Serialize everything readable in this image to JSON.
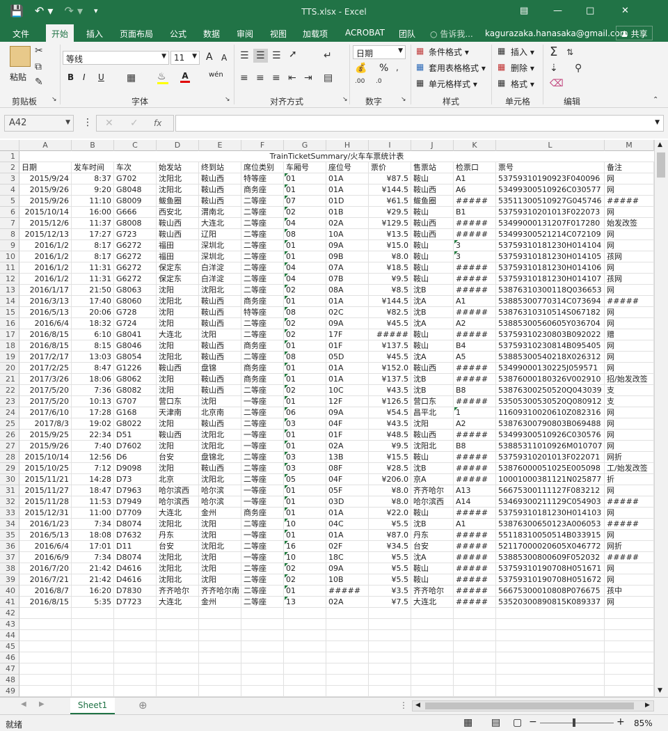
{
  "app": {
    "title": "TTS.xlsx - Excel"
  },
  "menu": [
    "文件",
    "开始",
    "插入",
    "页面布局",
    "公式",
    "数据",
    "审阅",
    "视图",
    "加载项",
    "ACROBAT",
    "团队"
  ],
  "tell_me": "告诉我...",
  "account": "kagurazaka.hanasaka@gmail.com",
  "share": "共享",
  "ribbon": {
    "clipboard": {
      "label": "剪贴板",
      "paste": "粘贴"
    },
    "font": {
      "label": "字体",
      "name": "等线",
      "size": "11",
      "bold": "B",
      "italic": "I",
      "underline": "U",
      "grow": "A",
      "shrink": "A",
      "phonetic": "wén"
    },
    "alignment": {
      "label": "对齐方式"
    },
    "number": {
      "label": "数字",
      "format": "日期",
      "percent": "%"
    },
    "styles": {
      "label": "样式",
      "conditional": "条件格式",
      "table": "套用表格格式",
      "cell": "单元格样式"
    },
    "cells": {
      "label": "单元格",
      "insert": "插入",
      "delete": "删除",
      "format": "格式"
    },
    "editing": {
      "label": "编辑"
    }
  },
  "formula_bar": {
    "name_box": "A42",
    "fx": "fx",
    "formula": ""
  },
  "columns": [
    "A",
    "B",
    "C",
    "D",
    "E",
    "F",
    "G",
    "H",
    "I",
    "J",
    "K",
    "L",
    "M"
  ],
  "sheet_title": "TrainTicketSummary/火车车票统计表",
  "headers": [
    "日期",
    "发车时间",
    "车次",
    "始发站",
    "终到站",
    "席位类别",
    "车厢号",
    "座位号",
    "票价",
    "售票站",
    "检票口",
    "票号",
    "备注"
  ],
  "rows": [
    [
      "2015/9/24",
      "8:37",
      "G702",
      "沈阳北",
      "鞍山西",
      "特等座",
      "01",
      "01A",
      "¥87.5",
      "鞍山",
      "A1",
      "53759310190923F040096",
      "网"
    ],
    [
      "2015/9/26",
      "9:20",
      "G8048",
      "沈阳北",
      "鞍山西",
      "商务座",
      "01",
      "01A",
      "¥144.5",
      "鞍山西",
      "A6",
      "53499300510926C030577",
      "网"
    ],
    [
      "2015/9/26",
      "11:10",
      "G8009",
      "鲅鱼圈",
      "鞍山西",
      "二等座",
      "07",
      "01D",
      "¥61.5",
      "鲅鱼圈",
      "#####",
      "53511300510927G045746",
      "#####"
    ],
    [
      "2015/10/14",
      "16:00",
      "G666",
      "西安北",
      "渭南北",
      "二等座",
      "02",
      "01B",
      "¥29.5",
      "鞍山",
      "B1",
      "53759310201013F022073",
      "网"
    ],
    [
      "2015/12/6",
      "11:37",
      "G8008",
      "鞍山西",
      "大连北",
      "二等座",
      "04",
      "02A",
      "¥129.5",
      "鞍山西",
      "#####",
      "53499000131207F017280",
      "始发改签"
    ],
    [
      "2015/12/13",
      "17:27",
      "G723",
      "鞍山西",
      "辽阳",
      "二等座",
      "08",
      "10A",
      "¥13.5",
      "鞍山西",
      "#####",
      "53499300521214C072109",
      "网"
    ],
    [
      "2016/1/2",
      "8:17",
      "G6272",
      "福田",
      "深圳北",
      "二等座",
      "01",
      "09A",
      "¥15.0",
      "鞍山",
      "3",
      "53759310181230H014104",
      "网"
    ],
    [
      "2016/1/2",
      "8:17",
      "G6272",
      "福田",
      "深圳北",
      "二等座",
      "01",
      "09B",
      "¥8.0",
      "鞍山",
      "3",
      "53759310181230H014105",
      "孩网"
    ],
    [
      "2016/1/2",
      "11:31",
      "G6272",
      "保定东",
      "白洋淀",
      "二等座",
      "04",
      "07A",
      "¥18.5",
      "鞍山",
      "#####",
      "53759310181230H014106",
      "网"
    ],
    [
      "2016/1/2",
      "11:31",
      "G6272",
      "保定东",
      "白洋淀",
      "二等座",
      "04",
      "07B",
      "¥9.5",
      "鞍山",
      "#####",
      "53759310181230H014107",
      "孩网"
    ],
    [
      "2016/1/17",
      "21:50",
      "G8063",
      "沈阳",
      "沈阳北",
      "二等座",
      "02",
      "08A",
      "¥8.5",
      "沈B",
      "#####",
      "53876310300118Q036653",
      "网"
    ],
    [
      "2016/3/13",
      "17:40",
      "G8060",
      "沈阳北",
      "鞍山西",
      "商务座",
      "01",
      "01A",
      "¥144.5",
      "沈A",
      "A1",
      "53885300770314C073694",
      "#####"
    ],
    [
      "2016/5/13",
      "20:06",
      "G728",
      "沈阳",
      "鞍山西",
      "特等座",
      "08",
      "02C",
      "¥82.5",
      "沈B",
      "#####",
      "53876310310514S067182",
      "网"
    ],
    [
      "2016/6/4",
      "18:32",
      "G724",
      "沈阳",
      "鞍山西",
      "二等座",
      "02",
      "09A",
      "¥45.5",
      "沈A",
      "A2",
      "53885300560605Y036704",
      "网"
    ],
    [
      "2016/8/15",
      "6:10",
      "G8041",
      "大连北",
      "沈阳",
      "二等座",
      "02",
      "17F",
      "#####",
      "鞍山",
      "#####",
      "53759310230803B092022",
      "赠"
    ],
    [
      "2016/8/15",
      "8:15",
      "G8046",
      "沈阳",
      "鞍山西",
      "商务座",
      "01",
      "01F",
      "¥137.5",
      "鞍山",
      "B4",
      "53759310230814B095405",
      "网"
    ],
    [
      "2017/2/17",
      "13:03",
      "G8054",
      "沈阳北",
      "鞍山西",
      "二等座",
      "08",
      "05D",
      "¥45.5",
      "沈A",
      "A5",
      "53885300540218X026312",
      "网"
    ],
    [
      "2017/2/25",
      "8:47",
      "G1226",
      "鞍山西",
      "盘锦",
      "商务座",
      "01",
      "01A",
      "¥152.0",
      "鞍山西",
      "#####",
      "53499000130225J059571",
      "网"
    ],
    [
      "2017/3/26",
      "18:06",
      "G8062",
      "沈阳",
      "鞍山西",
      "商务座",
      "01",
      "01A",
      "¥137.5",
      "沈B",
      "#####",
      "53876000180326V002910",
      "招/始发改签"
    ],
    [
      "2017/5/20",
      "7:36",
      "G8082",
      "沈阳",
      "鞍山西",
      "二等座",
      "02",
      "10C",
      "¥43.5",
      "沈B",
      "B8",
      "53876300250520Q043039",
      "支"
    ],
    [
      "2017/5/20",
      "10:13",
      "G707",
      "营口东",
      "沈阳",
      "一等座",
      "01",
      "12F",
      "¥126.5",
      "营口东",
      "#####",
      "53505300530520Q080912",
      "支"
    ],
    [
      "2017/6/10",
      "17:28",
      "G168",
      "天津南",
      "北京南",
      "二等座",
      "06",
      "09A",
      "¥54.5",
      "昌平北",
      "1",
      "11609310020610Z082316",
      "网"
    ],
    [
      "2017/8/3",
      "19:02",
      "G8022",
      "沈阳",
      "鞍山西",
      "二等座",
      "03",
      "04F",
      "¥43.5",
      "沈阳",
      "A2",
      "53876300790803B069488",
      "网"
    ],
    [
      "2015/9/25",
      "22:34",
      "D51",
      "鞍山西",
      "沈阳北",
      "一等座",
      "01",
      "01F",
      "¥48.5",
      "鞍山西",
      "#####",
      "53499300510926C030576",
      "网"
    ],
    [
      "2015/9/26",
      "7:40",
      "D7602",
      "沈阳",
      "沈阳北",
      "一等座",
      "01",
      "02A",
      "¥9.5",
      "沈阳北",
      "B8",
      "53885311010926M010707",
      "网"
    ],
    [
      "2015/10/14",
      "12:56",
      "D6",
      "台安",
      "盘锦北",
      "二等座",
      "03",
      "13B",
      "¥15.5",
      "鞍山",
      "#####",
      "53759310201013F022071",
      "网折"
    ],
    [
      "2015/10/25",
      "7:12",
      "D9098",
      "沈阳",
      "鞍山西",
      "二等座",
      "03",
      "08F",
      "¥28.5",
      "沈B",
      "#####",
      "53876000051025E005098",
      "工/始发改签"
    ],
    [
      "2015/11/21",
      "14:28",
      "D73",
      "北京",
      "沈阳北",
      "二等座",
      "05",
      "04F",
      "¥206.0",
      "京A",
      "#####",
      "10001000381121N025877",
      "折"
    ],
    [
      "2015/11/27",
      "18:47",
      "D7963",
      "哈尔滨西",
      "哈尔滨",
      "一等座",
      "01",
      "05F",
      "¥8.0",
      "齐齐哈尔",
      "A13",
      "56675300111127F083212",
      "网"
    ],
    [
      "2015/11/28",
      "11:53",
      "D7949",
      "哈尔滨西",
      "哈尔滨",
      "一等座",
      "01",
      "03D",
      "¥8.0",
      "哈尔滨西",
      "A14",
      "53469300211129C054903",
      "#####"
    ],
    [
      "2015/12/31",
      "11:00",
      "D7709",
      "大连北",
      "金州",
      "商务座",
      "01",
      "01A",
      "¥22.0",
      "鞍山",
      "#####",
      "53759310181230H014103",
      "网"
    ],
    [
      "2016/1/23",
      "7:34",
      "D8074",
      "沈阳北",
      "沈阳",
      "二等座",
      "10",
      "04C",
      "¥5.5",
      "沈B",
      "A1",
      "53876300650123A006053",
      "#####"
    ],
    [
      "2016/5/13",
      "18:08",
      "D7632",
      "丹东",
      "沈阳",
      "一等座",
      "01",
      "01A",
      "¥87.0",
      "丹东",
      "#####",
      "55118310050514B033915",
      "网"
    ],
    [
      "2016/6/4",
      "17:01",
      "D11",
      "台安",
      "沈阳北",
      "二等座",
      "16",
      "02F",
      "¥34.5",
      "台安",
      "#####",
      "52117000020605X046772",
      "网折"
    ],
    [
      "2016/6/9",
      "7:34",
      "D8074",
      "沈阳北",
      "沈阳",
      "一等座",
      "10",
      "18C",
      "¥5.5",
      "沈A",
      "#####",
      "53885300800609F052032",
      "#####"
    ],
    [
      "2016/7/20",
      "21:42",
      "D4616",
      "沈阳北",
      "沈阳",
      "二等座",
      "02",
      "09A",
      "¥5.5",
      "鞍山",
      "#####",
      "53759310190708H051671",
      "网"
    ],
    [
      "2016/7/21",
      "21:42",
      "D4616",
      "沈阳北",
      "沈阳",
      "二等座",
      "02",
      "10B",
      "¥5.5",
      "鞍山",
      "#####",
      "53759310190708H051672",
      "网"
    ],
    [
      "2016/8/7",
      "16:20",
      "D7830",
      "齐齐哈尔",
      "齐齐哈尔南",
      "二等座",
      "01",
      "#####",
      "¥3.5",
      "齐齐哈尔",
      "#####",
      "56675300010808P076675",
      "孩中"
    ],
    [
      "2016/8/15",
      "5:35",
      "D7723",
      "大连北",
      "金州",
      "二等座",
      "13",
      "02A",
      "¥7.5",
      "大连北",
      "#####",
      "53520300890815K089337",
      "网"
    ]
  ],
  "row_numbers": [
    "1",
    "2",
    "3",
    "4",
    "5",
    "6",
    "7",
    "8",
    "9",
    "10",
    "11",
    "12",
    "13",
    "14",
    "15",
    "16",
    "17",
    "18",
    "19",
    "20",
    "21",
    "22",
    "23",
    "24",
    "25",
    "26",
    "27",
    "28",
    "29",
    "30",
    "31",
    "32",
    "33",
    "34",
    "35",
    "36",
    "37",
    "38",
    "39",
    "40",
    "41",
    "42",
    "43",
    "44",
    "45",
    "46",
    "47",
    "48",
    "49"
  ],
  "sheet_tab": "Sheet1",
  "status": {
    "ready": "就绪",
    "zoom": "85%"
  },
  "colors": {
    "accent": "#217346"
  }
}
